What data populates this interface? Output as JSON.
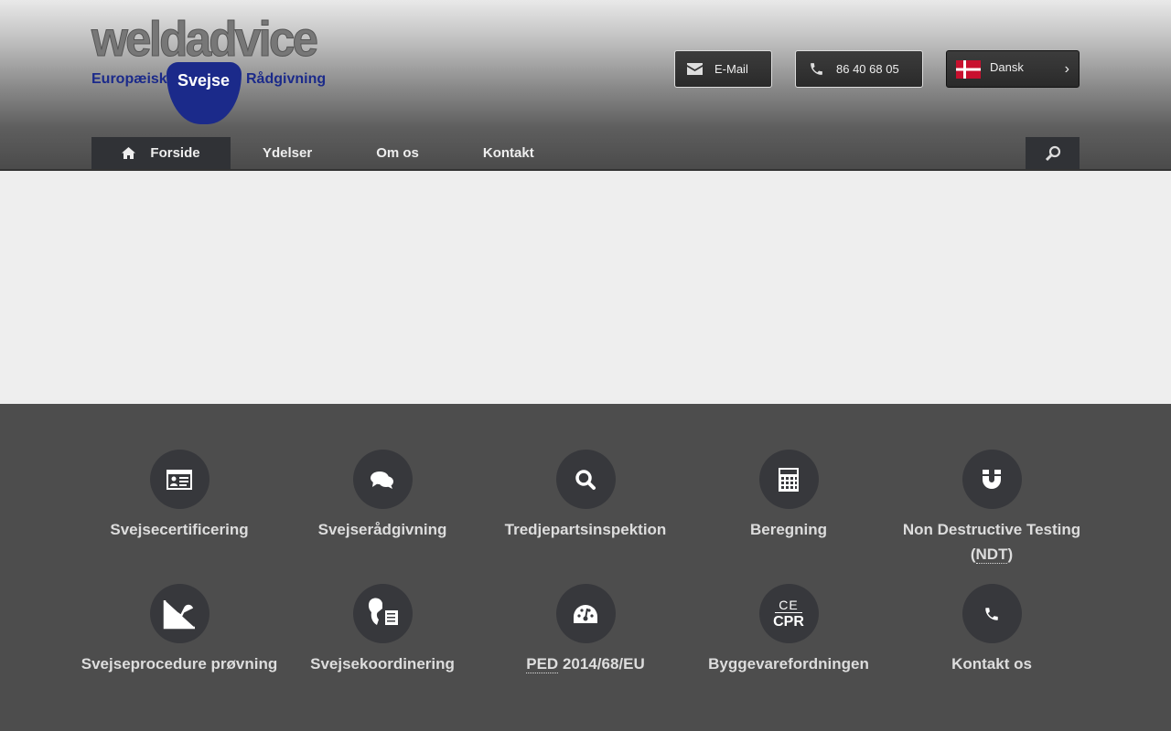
{
  "logo": {
    "word": "weldadvice",
    "left": "Europæisk",
    "middle": "Svejse",
    "right": "Rådgivning"
  },
  "header": {
    "email_label": "E-Mail",
    "phone_label": "86 40 68 05",
    "language_label": "Dansk"
  },
  "nav": {
    "items": [
      {
        "label": "Forside"
      },
      {
        "label": "Ydelser"
      },
      {
        "label": "Om os"
      },
      {
        "label": "Kontakt"
      }
    ]
  },
  "services": [
    {
      "label": "Svejsecertificering",
      "icon": "id-card-icon"
    },
    {
      "label": "Svejserådgivning",
      "icon": "chat-icon"
    },
    {
      "label": "Tredjepartsinspektion",
      "icon": "search-icon"
    },
    {
      "label": "Beregning",
      "icon": "calculator-icon"
    },
    {
      "label_a": "Non Destructive Testing (",
      "abbr": "NDT",
      "label_b": ")",
      "icon": "magnet-icon"
    },
    {
      "label": "Svejseprocedure prøvning",
      "icon": "graph-icon"
    },
    {
      "label": "Svejsekoordinering",
      "icon": "welder-icon"
    },
    {
      "abbr": "PED",
      "label_b": " 2014/68/EU",
      "icon": "gauge-icon"
    },
    {
      "label": "Byggevarefordningen",
      "icon": "ce-cpr-icon",
      "icon_text_top": "CE",
      "icon_text_bottom": "CPR"
    },
    {
      "label": "Kontakt os",
      "icon": "phone-icon"
    }
  ],
  "colors": {
    "brand_blue": "#1b2a8a",
    "footer_bg": "#4d4d4d",
    "circle": "#37383c"
  }
}
